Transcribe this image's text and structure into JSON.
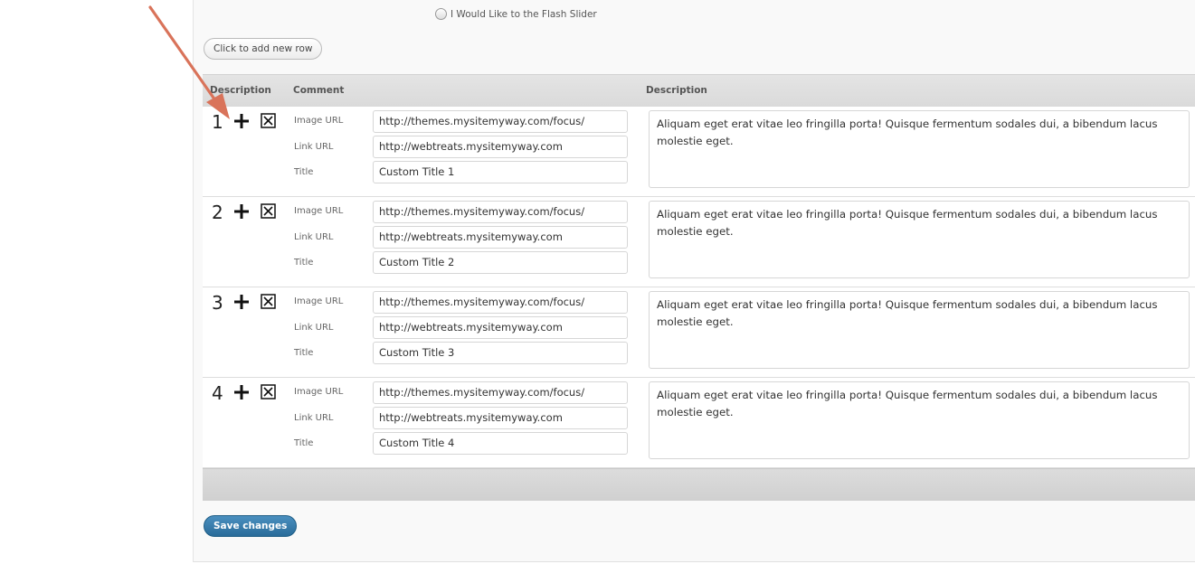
{
  "options": {
    "flash_slider_label": "I Would Like to the Flash Slider"
  },
  "toolbar": {
    "add_row_label": "Click to add new row",
    "save_label": "Save changes"
  },
  "table": {
    "headers": {
      "col_description": "Description",
      "col_comment": "Comment",
      "col_description2": "Description"
    },
    "field_labels": {
      "image_url": "Image URL",
      "link_url": "Link URL",
      "title": "Title"
    },
    "rows": [
      {
        "number": "1",
        "image_url": "http://themes.mysitemyway.com/focus/",
        "link_url": "http://webtreats.mysitemyway.com",
        "title": "Custom Title 1",
        "description": "Aliquam eget erat vitae leo fringilla porta! Quisque fermentum sodales dui, a bibendum lacus molestie eget."
      },
      {
        "number": "2",
        "image_url": "http://themes.mysitemyway.com/focus/",
        "link_url": "http://webtreats.mysitemyway.com",
        "title": "Custom Title 2",
        "description": "Aliquam eget erat vitae leo fringilla porta! Quisque fermentum sodales dui, a bibendum lacus molestie eget."
      },
      {
        "number": "3",
        "image_url": "http://themes.mysitemyway.com/focus/",
        "link_url": "http://webtreats.mysitemyway.com",
        "title": "Custom Title 3",
        "description": "Aliquam eget erat vitae leo fringilla porta! Quisque fermentum sodales dui, a bibendum lacus molestie eget."
      },
      {
        "number": "4",
        "image_url": "http://themes.mysitemyway.com/focus/",
        "link_url": "http://webtreats.mysitemyway.com",
        "title": "Custom Title 4",
        "description": "Aliquam eget erat vitae leo fringilla porta! Quisque fermentum sodales dui, a bibendum lacus molestie eget."
      }
    ]
  },
  "icons": {
    "move": "move-cross-icon",
    "delete": "delete-box-icon",
    "annotation": "arrow-annotation-icon"
  },
  "colors": {
    "save_button": "#2a6c9a",
    "annotation_arrow": "#d9735a"
  }
}
